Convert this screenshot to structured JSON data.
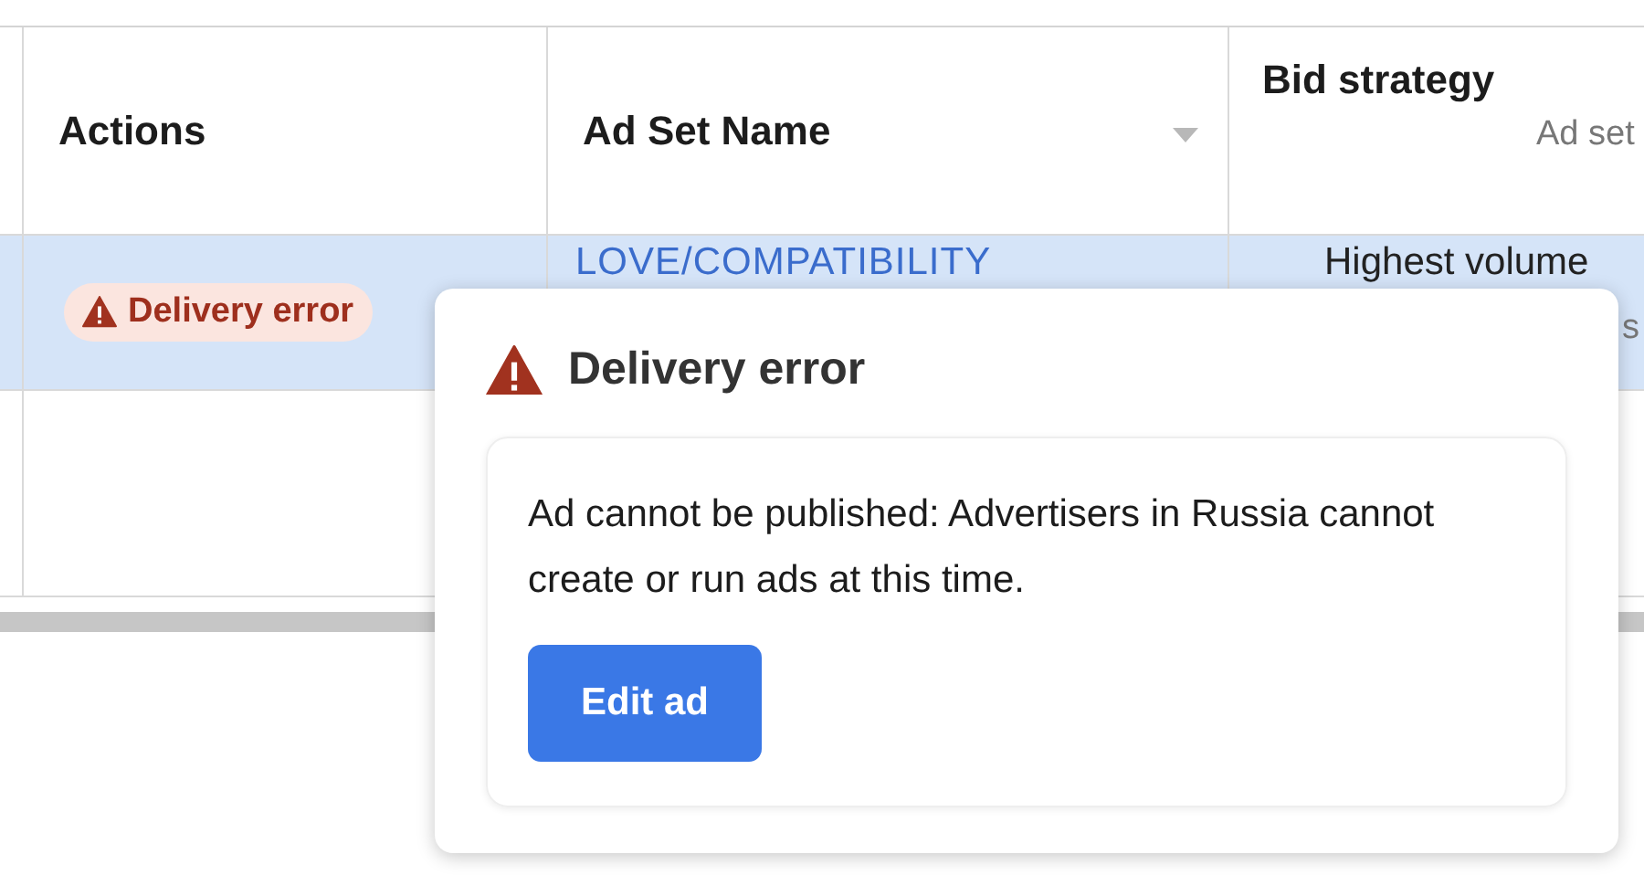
{
  "table": {
    "columns": [
      {
        "label": "Actions"
      },
      {
        "label": "Ad Set Name"
      },
      {
        "label": "Bid strategy",
        "sublabel": "Ad set"
      }
    ],
    "rows": [
      {
        "selected": true,
        "status": {
          "kind": "error",
          "label": "Delivery error"
        },
        "ad_set_name": "LOVE/COMPATIBILITY",
        "bid_strategy": "Highest volume",
        "bid_detail": "s"
      }
    ]
  },
  "popover": {
    "kind": "error",
    "title": "Delivery error",
    "message": "Ad cannot be published: Advertisers in Russia cannot create or run ads at this time.",
    "button": "Edit ad"
  }
}
